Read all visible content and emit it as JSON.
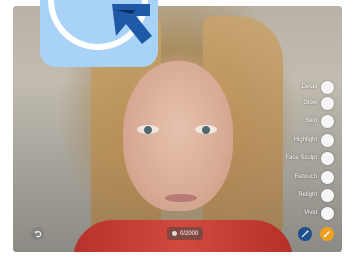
{
  "tools": [
    {
      "label": "Detail"
    },
    {
      "label": "Glow"
    },
    {
      "label": "Skin"
    },
    {
      "label": "Highlight"
    },
    {
      "label": "Face Sculpt"
    },
    {
      "label": "Retouch"
    },
    {
      "label": "Relight"
    },
    {
      "label": "Vivid"
    }
  ],
  "counter": {
    "text": "0/2000"
  },
  "colors": {
    "icon_bg": "#a9d2f7",
    "icon_arrow": "#1e5aa8",
    "blue_button": "#1f4f8c",
    "orange_button": "#f0a020"
  },
  "icons": {
    "app": "blue-arrow-cursor-icon",
    "undo": "undo-icon",
    "counter": "circle-dot-icon",
    "blue_button": "magic-icon",
    "orange_button": "brush-icon"
  }
}
